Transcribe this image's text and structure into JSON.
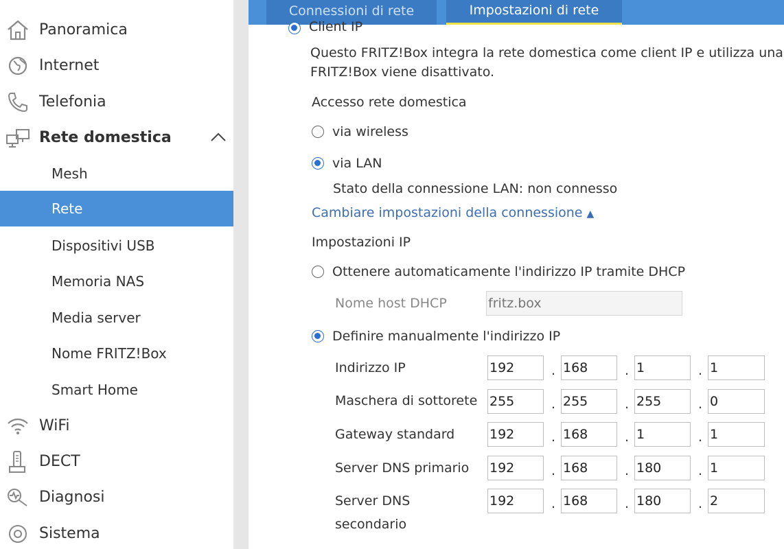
{
  "sidebar": {
    "items": [
      {
        "label": "Panoramica",
        "icon": "home-icon"
      },
      {
        "label": "Internet",
        "icon": "globe-icon"
      },
      {
        "label": "Telefonia",
        "icon": "phone-icon"
      },
      {
        "label": "Rete domestica",
        "icon": "network-icon"
      },
      {
        "label": "WiFi",
        "icon": "wifi-icon"
      },
      {
        "label": "DECT",
        "icon": "dect-phone-icon"
      },
      {
        "label": "Diagnosi",
        "icon": "diagnosis-icon"
      },
      {
        "label": "Sistema",
        "icon": "system-icon"
      }
    ],
    "subitems": [
      "Mesh",
      "Rete",
      "Dispositivi USB",
      "Memoria NAS",
      "Media server",
      "Nome FRITZ!Box",
      "Smart Home"
    ],
    "active_subitem": "Rete"
  },
  "tabs": [
    "Connessioni di rete",
    "Impostazioni di rete"
  ],
  "active_tab": "Impostazioni di rete",
  "content": {
    "client_ip_label": "Client IP",
    "description_line1": "Questo FRITZ!Box integra la rete domestica come client IP e utilizza una co",
    "description_line2": "FRITZ!Box viene disattivato.",
    "access_heading": "Accesso rete domestica",
    "via_wireless": "via wireless",
    "via_lan": "via LAN",
    "lan_status": "Stato della connessione LAN: non connesso",
    "change_settings_link": "Cambiare impostazioni della connessione",
    "ip_settings_heading": "Impostazioni IP",
    "dhcp_option": "Ottenere automaticamente l'indirizzo IP tramite DHCP",
    "dhcp_hostname_label": "Nome host DHCP",
    "dhcp_hostname_placeholder": "fritz.box",
    "manual_option": "Definire manualmente l'indirizzo IP",
    "ip_rows": [
      {
        "label": "Indirizzo IP",
        "octets": [
          "192",
          "168",
          "1",
          "1"
        ]
      },
      {
        "label": "Maschera di sottorete",
        "octets": [
          "255",
          "255",
          "255",
          "0"
        ]
      },
      {
        "label": "Gateway standard",
        "octets": [
          "192",
          "168",
          "1",
          "1"
        ]
      },
      {
        "label": "Server DNS primario",
        "octets": [
          "192",
          "168",
          "180",
          "1"
        ]
      },
      {
        "label_line1": "Server DNS",
        "label_line2": "secondario",
        "octets": [
          "192",
          "168",
          "180",
          "2"
        ]
      }
    ],
    "octet_separator": "."
  },
  "colors": {
    "accent": "#4a90d9",
    "tab_underline": "#f0e24a",
    "radio": "#2a6fd0",
    "link": "#3c6db3"
  }
}
